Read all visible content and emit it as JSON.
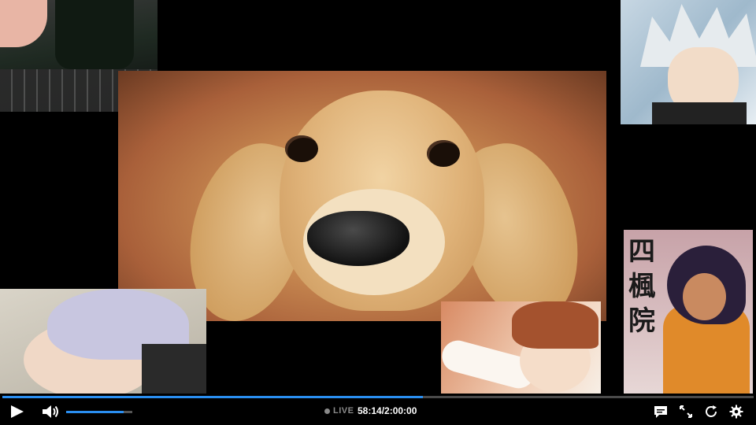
{
  "player": {
    "live_label": "LIVE",
    "time_display": "58:14/2:00:00",
    "progress_fraction": 0.56,
    "volume_fraction": 0.87
  },
  "overlay": {
    "kanji_text": "四\n楓\n院"
  },
  "icons": {
    "play": "play-icon",
    "volume": "volume-icon",
    "chat": "chat-icon",
    "fullscreen": "fullscreen-icon",
    "refresh": "refresh-icon",
    "settings": "gear-icon"
  },
  "colors": {
    "accent": "#2a8ef0",
    "bar_bg": "#000000",
    "muted": "#8a8a8a"
  }
}
